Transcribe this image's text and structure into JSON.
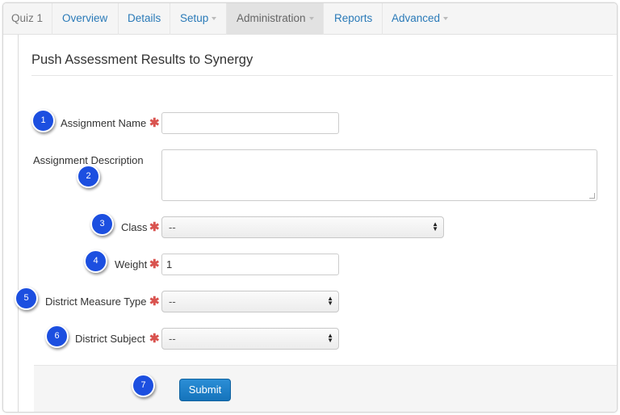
{
  "nav": {
    "brand": "Quiz 1",
    "items": [
      {
        "label": "Overview"
      },
      {
        "label": "Details"
      },
      {
        "label": "Setup"
      },
      {
        "label": "Administration"
      },
      {
        "label": "Reports"
      },
      {
        "label": "Advanced"
      }
    ]
  },
  "page": {
    "title": "Push Assessment Results to Synergy"
  },
  "form": {
    "required_marker": "✱",
    "assignment_name": {
      "label": "Assignment Name",
      "value": ""
    },
    "assignment_description": {
      "label": "Assignment Description",
      "value": ""
    },
    "class": {
      "label": "Class",
      "selected": "--"
    },
    "weight": {
      "label": "Weight",
      "value": "1"
    },
    "district_measure_type": {
      "label": "District Measure Type",
      "selected": "--"
    },
    "district_subject": {
      "label": "District Subject",
      "selected": "--"
    },
    "submit_label": "Submit"
  },
  "callouts": [
    "1",
    "2",
    "3",
    "4",
    "5",
    "6",
    "7"
  ],
  "colors": {
    "link": "#2a7ab8",
    "required": "#d9534f",
    "submit": "#1a7fc9",
    "callout": "#1c4fe0"
  }
}
